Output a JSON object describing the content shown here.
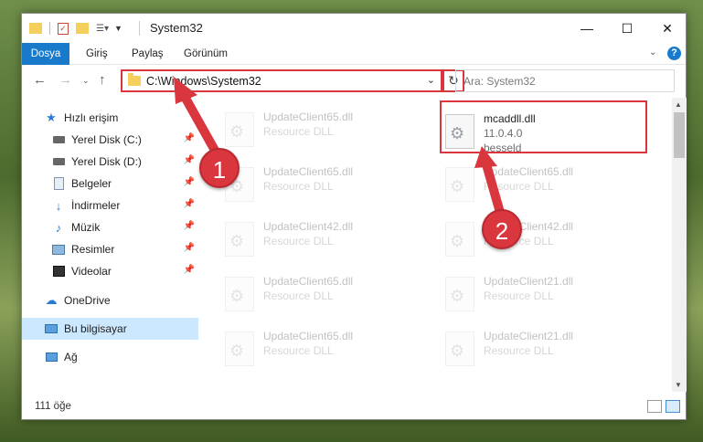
{
  "window": {
    "title": "System32",
    "controls": {
      "minimize": "—",
      "maximize": "☐",
      "close": "✕"
    }
  },
  "ribbon": {
    "tabs": [
      "Dosya",
      "Giriş",
      "Paylaş",
      "Görünüm"
    ],
    "file_tab_color": "#1979ca"
  },
  "address": {
    "path": "C:\\Windows\\System32",
    "search_placeholder": "Ara: System32",
    "highlight_color": "#d9363e"
  },
  "nav": {
    "items": [
      {
        "label": "Hızlı erişim",
        "icon": "star-icon"
      },
      {
        "label": "Yerel Disk (C:)",
        "icon": "drive-icon",
        "pinned": true
      },
      {
        "label": "Yerel Disk (D:)",
        "icon": "drive-icon",
        "pinned": true
      },
      {
        "label": "Belgeler",
        "icon": "documents-icon",
        "pinned": true
      },
      {
        "label": "İndirmeler",
        "icon": "download-icon",
        "pinned": true
      },
      {
        "label": "Müzik",
        "icon": "music-icon",
        "pinned": true
      },
      {
        "label": "Resimler",
        "icon": "pictures-icon",
        "pinned": true
      },
      {
        "label": "Videolar",
        "icon": "videos-icon",
        "pinned": true
      },
      {
        "label": "OneDrive",
        "icon": "cloud-icon"
      },
      {
        "label": "Bu bilgisayar",
        "icon": "computer-icon",
        "selected": true
      },
      {
        "label": "Ağ",
        "icon": "network-icon"
      }
    ]
  },
  "files": {
    "left_column": [
      {
        "name": "UpdateClient65.dll",
        "type": "Resource DLL"
      },
      {
        "name": "UpdateClient65.dll",
        "type": "Resource DLL"
      },
      {
        "name": "UpdateClient42.dll",
        "type": "Resource DLL"
      },
      {
        "name": "UpdateClient65.dll",
        "type": "Resource DLL"
      },
      {
        "name": "UpdateClient65.dll",
        "type": "Resource DLL"
      }
    ],
    "right_column": [
      {
        "name": "mcaddll.dll",
        "version": "11.0.4.0",
        "company": "besseld",
        "highlighted": true
      },
      {
        "name": "UpdateClient65.dll",
        "type": "Resource DLL"
      },
      {
        "name": "UpdateClient42.dll",
        "type": "Resource DLL"
      },
      {
        "name": "UpdateClient21.dll",
        "type": "Resource DLL"
      },
      {
        "name": "UpdateClient21.dll",
        "type": "Resource DLL"
      }
    ]
  },
  "status": {
    "item_count": "111 öğe"
  },
  "annotations": {
    "step1": "1",
    "step2": "2"
  }
}
